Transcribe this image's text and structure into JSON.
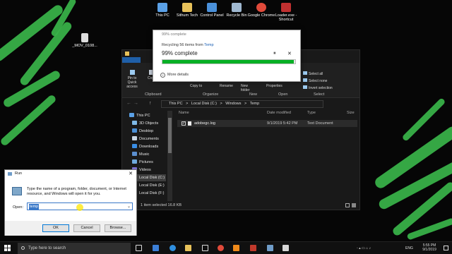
{
  "desktop": {
    "icons": [
      {
        "label": "This PC",
        "color": "#5aa0e6"
      },
      {
        "label": "Sithum Tech",
        "color": "#e8c25a"
      },
      {
        "label": "Control Panel",
        "color": "#4a90d9"
      },
      {
        "label": "Recycle Bin",
        "color": "#9fb8d0"
      },
      {
        "label": "Google Chrome",
        "color": "#e04a3a"
      },
      {
        "label": "Loader.exe - Shortcut",
        "color": "#c03030"
      }
    ],
    "left_icon_label": "_MOV_0108..."
  },
  "explorer": {
    "ribbon": {
      "pin_label": "Pin to Quick access",
      "copy_label": "Copy",
      "copy_to_label": "Copy to",
      "new_folder_label": "New folder",
      "properties_label": "Properties",
      "rename_label": "Rename",
      "select_all": "Select all",
      "select_none": "Select none",
      "invert_selection": "Invert selection",
      "groups": [
        "Clipboard",
        "Organize",
        "New",
        "Open",
        "Select"
      ]
    },
    "address": [
      "This PC",
      "Local Disk (C:)",
      "Windows",
      "Temp"
    ],
    "address_separator": ">",
    "nav_items": [
      "This PC",
      "3D Objects",
      "Desktop",
      "Documents",
      "Downloads",
      "Music",
      "Pictures",
      "Videos",
      "Local Disk (C:)",
      "Local Disk (E:)",
      "Local Disk (F:)"
    ],
    "columns": {
      "name": "Name",
      "date": "Date modified",
      "type": "Type",
      "size": "Size"
    },
    "files": [
      {
        "name": "adobegc.log",
        "date": "9/1/2019 5:42 PM",
        "type": "Text Document"
      }
    ],
    "status": "1 item selected  16.8 KB"
  },
  "progress_dialog": {
    "title": "99% complete",
    "subtitle_prefix": "Recycling 56 items from",
    "subtitle_link": "Temp",
    "percent_text": "99% complete",
    "progress": 0.99,
    "pause_symbol": "⏸",
    "close_symbol": "✕",
    "more_details": "More details",
    "fill_color": "#06b025"
  },
  "run_dialog": {
    "title": "Run",
    "close_symbol": "✕",
    "description": "Type the name of a program, folder, document, or Internet resource, and Windows will open it for you.",
    "open_label": "Open:",
    "input_value": "temp",
    "ok": "OK",
    "cancel": "Cancel",
    "browse": "Browse..."
  },
  "taskbar": {
    "search_placeholder": "Type here to search",
    "language": "ENG",
    "time": "5:55 PM",
    "date": "9/1/2019"
  },
  "colors": {
    "brush_green": "#39b54a",
    "accent_blue": "#0078d7"
  }
}
